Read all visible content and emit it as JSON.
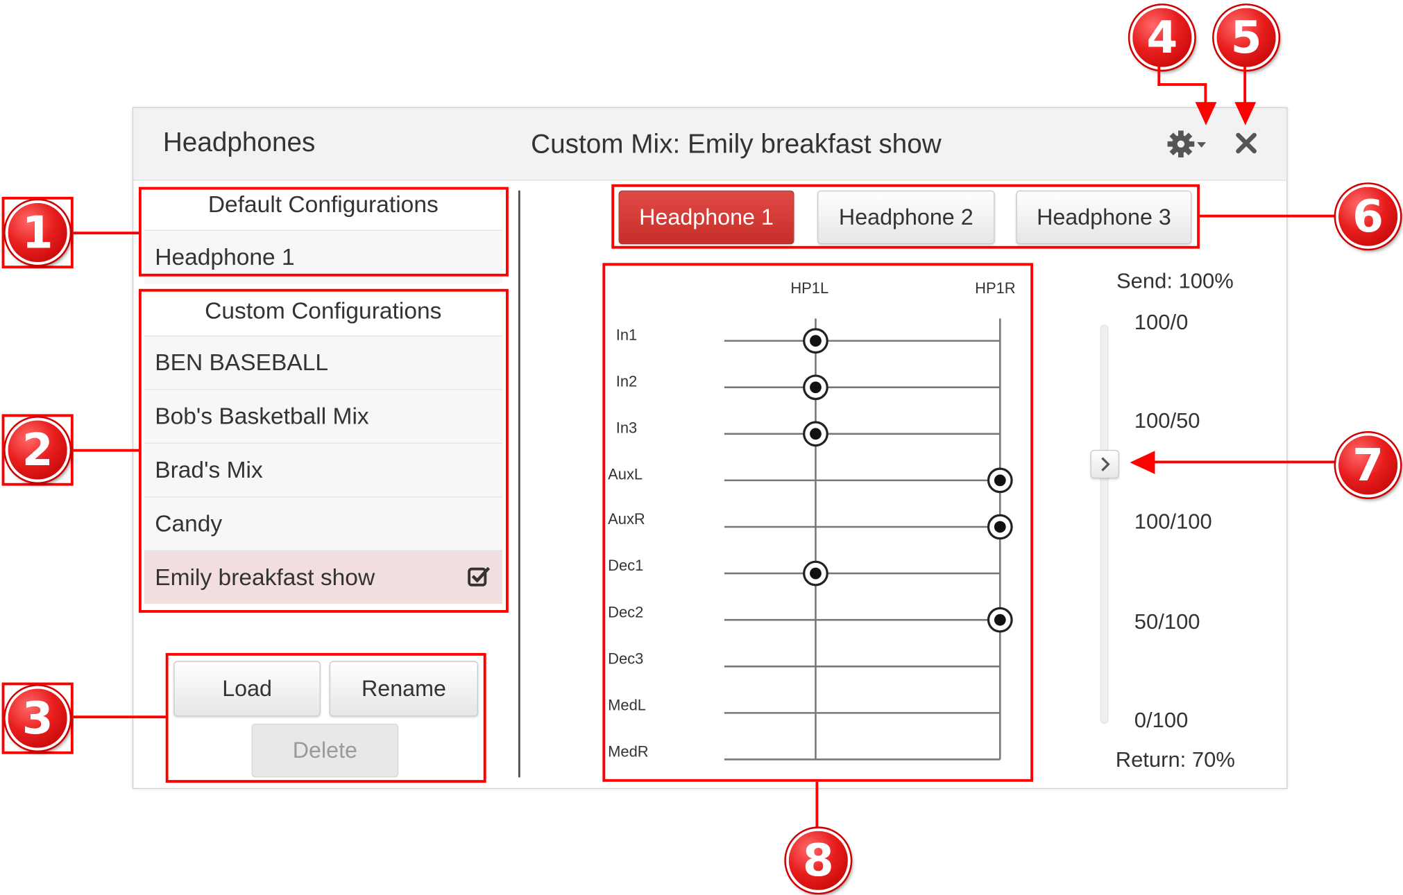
{
  "header": {
    "title": "Headphones",
    "mix_title": "Custom Mix: Emily breakfast show",
    "settings_icon": "gear-icon",
    "close_icon": "close-icon"
  },
  "default_configs": {
    "heading": "Default Configurations",
    "items": [
      "Headphone 1"
    ]
  },
  "custom_configs": {
    "heading": "Custom Configurations",
    "items": [
      {
        "label": "BEN BASEBALL",
        "selected": false
      },
      {
        "label": "Bob's Basketball Mix",
        "selected": false
      },
      {
        "label": "Brad's Mix",
        "selected": false
      },
      {
        "label": "Candy",
        "selected": false
      },
      {
        "label": "Emily breakfast show",
        "selected": true
      }
    ]
  },
  "actions": {
    "load": "Load",
    "rename": "Rename",
    "delete": "Delete"
  },
  "tabs": [
    {
      "label": "Headphone 1",
      "active": true
    },
    {
      "label": "Headphone 2",
      "active": false
    },
    {
      "label": "Headphone 3",
      "active": false
    }
  ],
  "matrix": {
    "columns": [
      "HP1L",
      "HP1R"
    ],
    "rows": [
      "In1",
      "In2",
      "In3",
      "AuxL",
      "AuxR",
      "Dec1",
      "Dec2",
      "Dec3",
      "MedL",
      "MedR"
    ],
    "routing": {
      "In1": "HP1L",
      "In2": "HP1L",
      "In3": "HP1L",
      "AuxL": "HP1R",
      "AuxR": "HP1R",
      "Dec1": "HP1L",
      "Dec2": "HP1R"
    }
  },
  "mix_slider": {
    "send_label": "Send: 100%",
    "return_label": "Return: 70%",
    "scale": [
      "100/0",
      "100/50",
      "100/100",
      "50/100",
      "0/100"
    ],
    "handle_icon": "chevron-right-icon"
  },
  "callouts": [
    "1",
    "2",
    "3",
    "4",
    "5",
    "6",
    "7",
    "8"
  ],
  "colors": {
    "accent": "#d9413d",
    "callout": "#ff0000",
    "selected_row": "#f2dede"
  }
}
